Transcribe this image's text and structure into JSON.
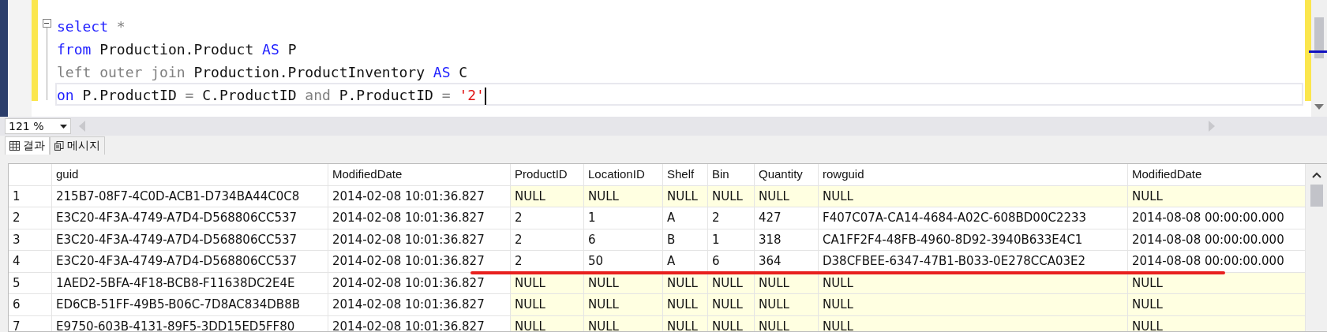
{
  "editor": {
    "lines": [
      {
        "current": false,
        "tokens": [
          {
            "kind": "keyword",
            "text": "select"
          },
          {
            "kind": "operator",
            "text": " *"
          }
        ]
      },
      {
        "current": false,
        "tokens": [
          {
            "kind": "keyword",
            "text": "from"
          },
          {
            "kind": "plain",
            "text": " Production.Product "
          },
          {
            "kind": "keyword",
            "text": "AS"
          },
          {
            "kind": "plain",
            "text": " P"
          }
        ]
      },
      {
        "current": false,
        "tokens": [
          {
            "kind": "operator",
            "text": "left outer join"
          },
          {
            "kind": "plain",
            "text": " Production.ProductInventory "
          },
          {
            "kind": "keyword",
            "text": "AS"
          },
          {
            "kind": "plain",
            "text": " C"
          }
        ]
      },
      {
        "current": true,
        "tokens": [
          {
            "kind": "keyword",
            "text": "on"
          },
          {
            "kind": "plain",
            "text": " P.ProductID "
          },
          {
            "kind": "operator",
            "text": "="
          },
          {
            "kind": "plain",
            "text": " C.ProductID "
          },
          {
            "kind": "operator",
            "text": "and"
          },
          {
            "kind": "plain",
            "text": " P.ProductID "
          },
          {
            "kind": "operator",
            "text": "= "
          },
          {
            "kind": "string",
            "text": "'2'"
          }
        ]
      }
    ]
  },
  "zoom": {
    "value": "121 %"
  },
  "tabs": [
    {
      "label": "결과",
      "selected": true,
      "kind": "grid"
    },
    {
      "label": "메시지",
      "selected": false,
      "kind": "messages"
    }
  ],
  "table": {
    "columns": [
      "guid",
      "ModifiedDate",
      "ProductID",
      "LocationID",
      "Shelf",
      "Bin",
      "Quantity",
      "rowguid",
      "ModifiedDate"
    ],
    "rows": [
      {
        "number": "1",
        "matched": false,
        "cells": [
          "215B7-08F7-4C0D-ACB1-D734BA44C0C8",
          "2014-02-08 10:01:36.827",
          "NULL",
          "NULL",
          "NULL",
          "NULL",
          "NULL",
          "NULL",
          "NULL"
        ]
      },
      {
        "number": "2",
        "matched": true,
        "cells": [
          "E3C20-4F3A-4749-A7D4-D568806CC537",
          "2014-02-08 10:01:36.827",
          "2",
          "1",
          "A",
          "2",
          "427",
          "F407C07A-CA14-4684-A02C-608BD00C2233",
          "2014-08-08 00:00:00.000"
        ]
      },
      {
        "number": "3",
        "matched": true,
        "cells": [
          "E3C20-4F3A-4749-A7D4-D568806CC537",
          "2014-02-08 10:01:36.827",
          "2",
          "6",
          "B",
          "1",
          "318",
          "CA1FF2F4-48FB-4960-8D92-3940B633E4C1",
          "2014-08-08 00:00:00.000"
        ]
      },
      {
        "number": "4",
        "matched": true,
        "cells": [
          "E3C20-4F3A-4749-A7D4-D568806CC537",
          "2014-02-08 10:01:36.827",
          "2",
          "50",
          "A",
          "6",
          "364",
          "D38CFBEE-6347-47B1-B033-0E278CCA03E2",
          "2014-08-08 00:00:00.000"
        ]
      },
      {
        "number": "5",
        "matched": false,
        "cells": [
          "1AED2-5BFA-4F18-BCB8-F11638DC2E4E",
          "2014-02-08 10:01:36.827",
          "NULL",
          "NULL",
          "NULL",
          "NULL",
          "NULL",
          "NULL",
          "NULL"
        ]
      },
      {
        "number": "6",
        "matched": false,
        "cells": [
          "ED6CB-51FF-49B5-B06C-7D8AC834DB8B",
          "2014-02-08 10:01:36.827",
          "NULL",
          "NULL",
          "NULL",
          "NULL",
          "NULL",
          "NULL",
          "NULL"
        ]
      },
      {
        "number": "7",
        "matched": false,
        "cells": [
          "E9750-603B-4131-89F5-3DD15ED5FF80",
          "2014-02-08 10:01:36.827",
          "NULL",
          "NULL",
          "NULL",
          "NULL",
          "NULL",
          "NULL",
          "NULL"
        ]
      }
    ]
  }
}
